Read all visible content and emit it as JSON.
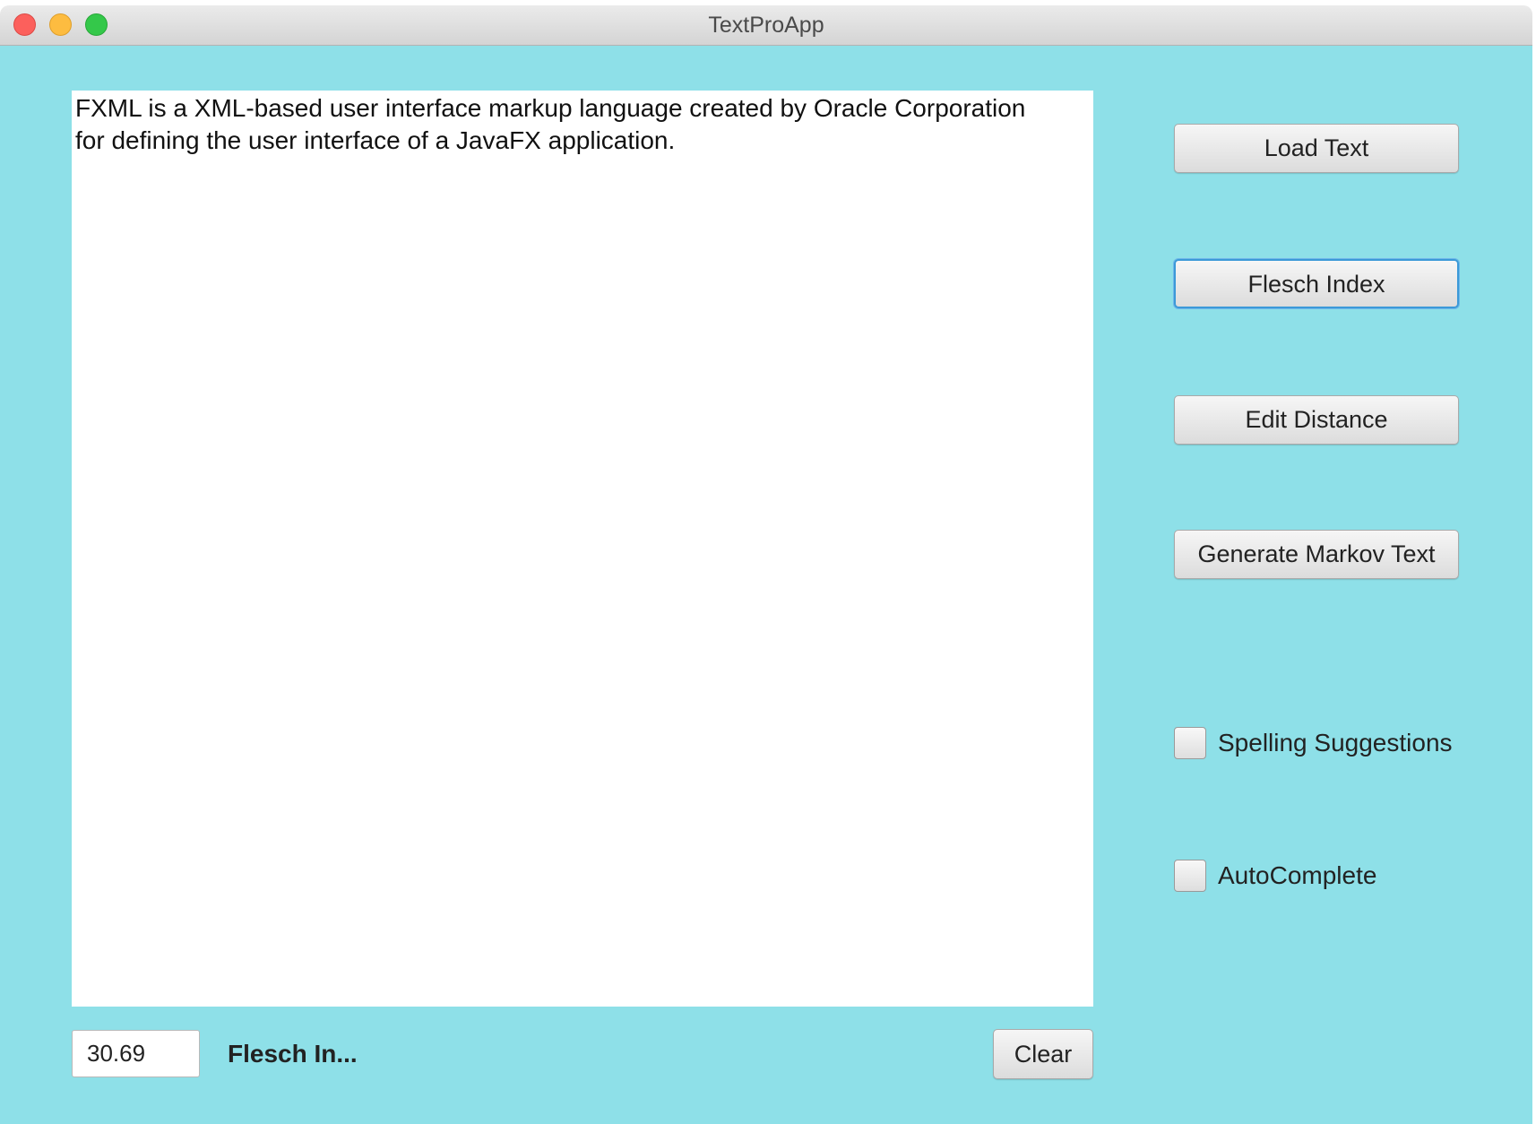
{
  "window": {
    "title": "TextProApp"
  },
  "editor": {
    "text": "FXML is a XML-based user interface markup language created by Oracle Corporation\nfor defining the user interface of a JavaFX application."
  },
  "sidebar": {
    "load_text": "Load Text",
    "flesch_index": "Flesch Index",
    "edit_distance": "Edit Distance",
    "generate_markov": "Generate Markov Text",
    "spelling_suggestions": {
      "label": "Spelling Suggestions",
      "checked": false
    },
    "autocomplete": {
      "label": "AutoComplete",
      "checked": false
    }
  },
  "bottom": {
    "score_value": "30.69",
    "score_label": "Flesch In...",
    "clear_label": "Clear"
  },
  "colors": {
    "background": "#8ee0e8",
    "focus_ring": "#3b99d8"
  }
}
